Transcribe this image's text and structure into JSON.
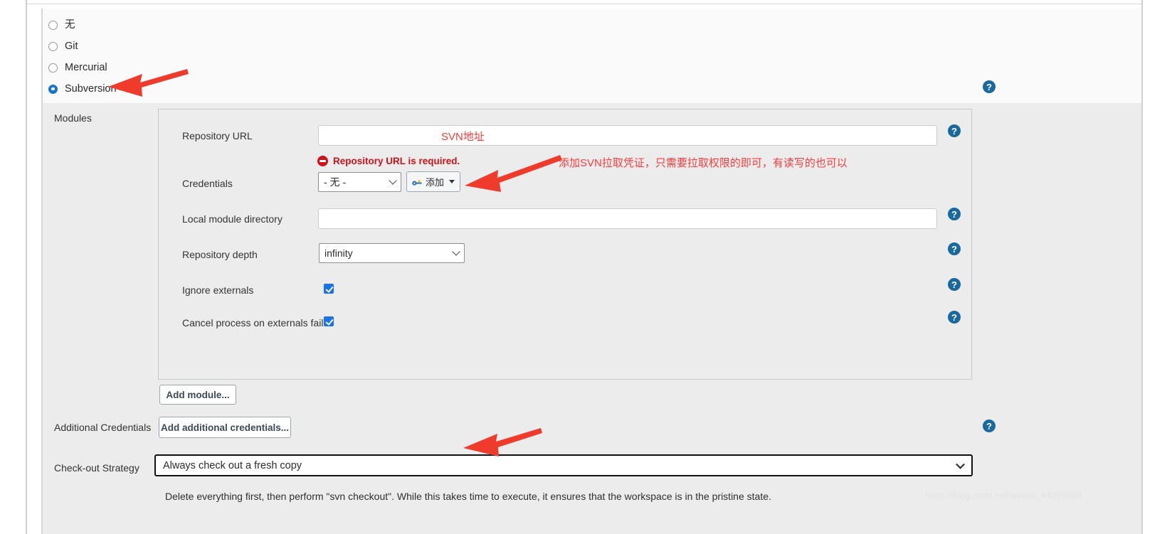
{
  "scm": {
    "options": [
      {
        "label": "无",
        "selected": false
      },
      {
        "label": "Git",
        "selected": false
      },
      {
        "label": "Mercurial",
        "selected": false
      },
      {
        "label": "Subversion",
        "selected": true
      }
    ],
    "help_label": "?"
  },
  "modules": {
    "section_label": "Modules",
    "repository_url": {
      "label": "Repository URL",
      "value": "",
      "placeholder": "",
      "help_label": "?"
    },
    "error": {
      "text": "Repository URL is required."
    },
    "credentials": {
      "label": "Credentials",
      "selected": "- 无 -",
      "add_button_label": "添加"
    },
    "local_module_directory": {
      "label": "Local module directory",
      "value": ".",
      "help_label": "?"
    },
    "repository_depth": {
      "label": "Repository depth",
      "selected": "infinity",
      "help_label": "?"
    },
    "ignore_externals": {
      "label": "Ignore externals",
      "checked": true,
      "help_label": "?"
    },
    "cancel_process_on_externals_fail": {
      "label": "Cancel process on externals fail",
      "checked": true,
      "help_label": "?"
    },
    "add_module_button": "Add module..."
  },
  "additional_credentials": {
    "label": "Additional Credentials",
    "button_label": "Add additional credentials...",
    "help_label": "?"
  },
  "checkout_strategy": {
    "label": "Check-out Strategy",
    "selected": "Always check out a fresh copy",
    "description": "Delete everything first, then perform \"svn checkout\". While this takes time to execute, it ensures that the workspace is in the pristine state."
  },
  "annotations": {
    "svn_url": "SVN地址",
    "credentials_note": "添加SVN拉取凭证，只需要拉取权限的即可，有读写的也可以"
  },
  "watermark": "https://blog.csdn.net/weixin_44296868",
  "colors": {
    "accent": "#1675d1",
    "error": "#d01218",
    "annotation": "#fa3c3c",
    "help_badge": "#19699e",
    "panel_bg": "#ececec"
  }
}
